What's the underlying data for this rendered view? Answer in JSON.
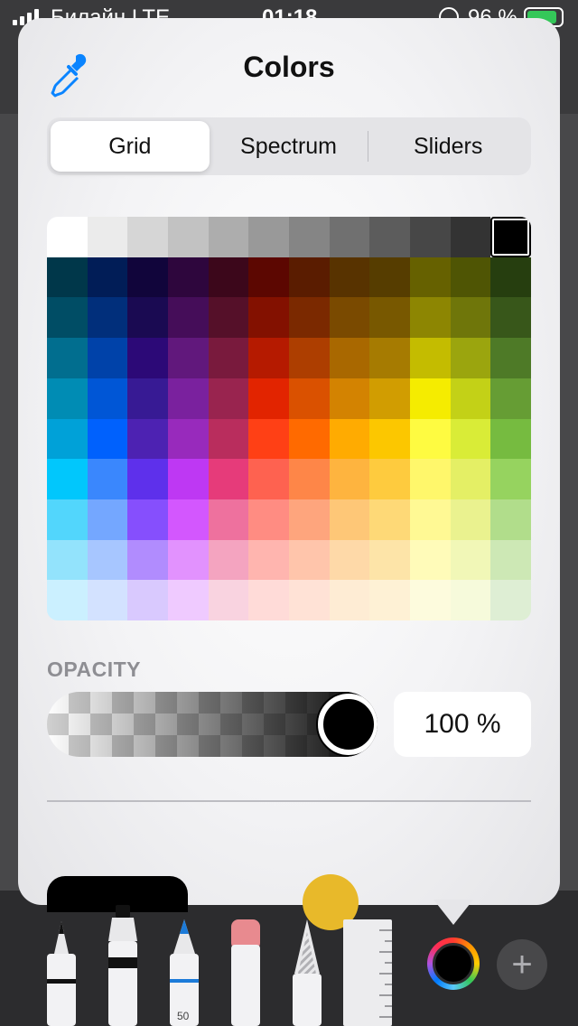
{
  "status_bar": {
    "carrier": "Билайн  LTE",
    "time": "01:18",
    "battery_percent": "96 %",
    "battery_level": 0.96
  },
  "popover": {
    "title": "Colors",
    "tabs": [
      {
        "label": "Grid",
        "active": true
      },
      {
        "label": "Spectrum",
        "active": false
      },
      {
        "label": "Sliders",
        "active": false
      }
    ],
    "opacity_label": "OPACITY",
    "opacity_value": "100 %",
    "opacity_level": 1.0,
    "selected_color": "#000000",
    "color_grid": [
      [
        "#ffffff",
        "#ebebeb",
        "#d6d6d6",
        "#c2c2c2",
        "#adadad",
        "#999999",
        "#858585",
        "#707070",
        "#5c5c5c",
        "#474747",
        "#333333",
        "#000000"
      ],
      [
        "#00374a",
        "#011d57",
        "#11053b",
        "#2e063d",
        "#3c071b",
        "#5c0701",
        "#5a1c00",
        "#583300",
        "#563d00",
        "#666100",
        "#4f5504",
        "#263e0f"
      ],
      [
        "#004d65",
        "#012f7b",
        "#1a0a52",
        "#450d59",
        "#551029",
        "#831100",
        "#7b2900",
        "#7a4a00",
        "#785800",
        "#8d8602",
        "#6f760a",
        "#38571a"
      ],
      [
        "#016e8f",
        "#0042a9",
        "#2c0977",
        "#61187c",
        "#791a3d",
        "#b51a00",
        "#ad3e00",
        "#a96800",
        "#a67b01",
        "#c4bc00",
        "#9ba50e",
        "#4e7a27"
      ],
      [
        "#008cb4",
        "#0056d6",
        "#371a94",
        "#7a219e",
        "#99244f",
        "#e22400",
        "#da5100",
        "#d38301",
        "#d19d01",
        "#f5ec00",
        "#c3d117",
        "#669d34"
      ],
      [
        "#00a1d8",
        "#0061fd",
        "#4d22b2",
        "#982abc",
        "#b92d5d",
        "#ff4015",
        "#ff6a00",
        "#ffab01",
        "#fcc700",
        "#fefb41",
        "#d9ec37",
        "#76bb40"
      ],
      [
        "#01c7fc",
        "#3a87fd",
        "#5e30eb",
        "#be38f3",
        "#e63b7a",
        "#fe6250",
        "#fe8648",
        "#feb43f",
        "#fecb3e",
        "#fff76b",
        "#e4ef65",
        "#96d35f"
      ],
      [
        "#52d6fc",
        "#74a7ff",
        "#864ffd",
        "#d357fe",
        "#ee719e",
        "#ff8c82",
        "#fea57d",
        "#fec777",
        "#fed977",
        "#fff994",
        "#eaf28f",
        "#b1dd8b"
      ],
      [
        "#93e3fc",
        "#a7c6ff",
        "#b18cfe",
        "#e292fe",
        "#f4a4c0",
        "#ffb5af",
        "#ffc5ab",
        "#fed9a8",
        "#fde4a8",
        "#fffbb9",
        "#f1f7b7",
        "#cde8b5"
      ],
      [
        "#cbf0ff",
        "#d3e2ff",
        "#d9c9fe",
        "#efcaff",
        "#f9d3e0",
        "#ffdbd8",
        "#ffe2d6",
        "#feecd4",
        "#fef1d5",
        "#fdfbdd",
        "#f6fadb",
        "#deeed4"
      ]
    ]
  },
  "toolbar": {
    "marker_size_label": "50",
    "tools": [
      "pen",
      "marker",
      "pencil",
      "eraser",
      "lasso",
      "ruler"
    ],
    "current_color": "#000000",
    "add_label": "+"
  }
}
